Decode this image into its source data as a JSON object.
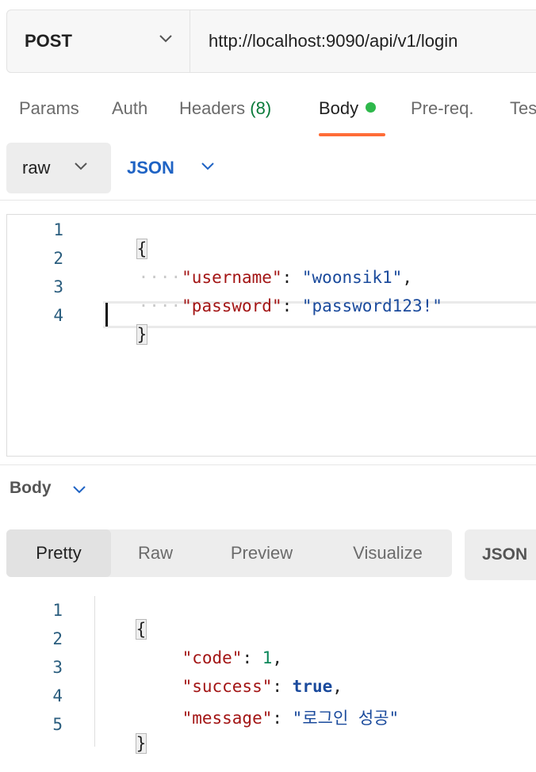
{
  "request": {
    "method": "POST",
    "url": "http://localhost:9090/api/v1/login"
  },
  "tabs": [
    {
      "label": "Params"
    },
    {
      "label": "Auth"
    },
    {
      "label": "Headers",
      "count": "(8)"
    },
    {
      "label": "Body"
    },
    {
      "label": "Pre-req."
    },
    {
      "label": "Tes"
    }
  ],
  "body_options": {
    "mode": "raw",
    "language": "JSON"
  },
  "request_editor": {
    "line_numbers": [
      "1",
      "2",
      "3",
      "4"
    ],
    "open_brace": "{",
    "close_brace": "}",
    "indent_dots": "····",
    "username_key": "\"username\"",
    "username_value": "\"woonsik1\"",
    "password_key": "\"password\"",
    "password_value": "\"password123!\""
  },
  "response": {
    "section_label": "Body",
    "view_tabs": [
      "Pretty",
      "Raw",
      "Preview",
      "Visualize"
    ],
    "selected_view": "Pretty",
    "format": "JSON",
    "line_numbers": [
      "1",
      "2",
      "3",
      "4",
      "5"
    ],
    "open_brace": "{",
    "close_brace": "}",
    "code_key": "\"code\"",
    "code_value": "1",
    "success_key": "\"success\"",
    "success_value": "true",
    "message_key": "\"message\"",
    "message_value": "\"로그인 성공\""
  },
  "colors": {
    "active_tab_underline": "#ff6c37",
    "body_dot": "#2eb84b",
    "json_keyword": "#1f63c4",
    "json_key": "#a31515",
    "json_string": "#1a4a9c"
  }
}
